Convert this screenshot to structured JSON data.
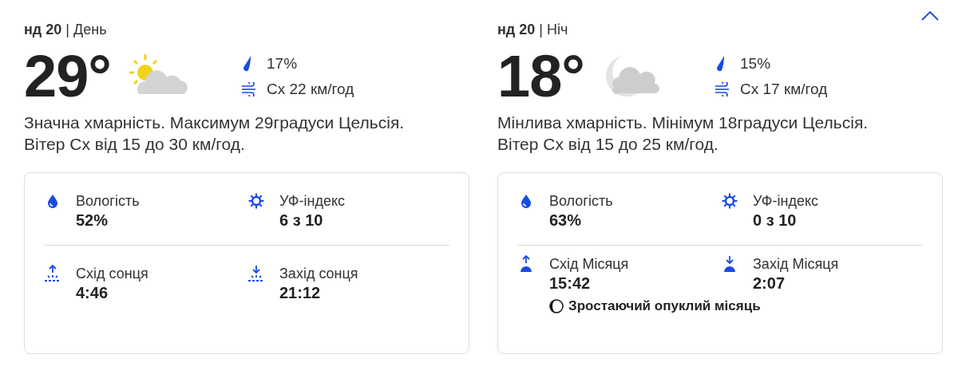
{
  "collapse_button": {
    "expanded": true
  },
  "periods": [
    {
      "heading": "**нд 20** | День",
      "temperature": "29°",
      "kind": "sun-cloud",
      "precipitation": "17%",
      "wind": "Сх 22 км/год",
      "description": "Значна хмарність. Максимум 29градуси Цельсія. Вітер Сх від 15 до 30 км/год.",
      "stats": [
        {
          "kind": "humidity",
          "label": "Вологість",
          "value": "52%"
        },
        {
          "kind": "uv",
          "label": "УФ-індекс",
          "value": "6 з 10"
        },
        {
          "kind": "sunrise",
          "label": "Схід сонця",
          "value": "4:46"
        },
        {
          "kind": "sunset",
          "label": "Захід сонця",
          "value": "21:12"
        }
      ]
    },
    {
      "heading": "**нд 20** | Ніч",
      "temperature": "18°",
      "kind": "moon-cloud",
      "precipitation": "15%",
      "wind": "Сх 17 км/год",
      "description": "Мінлива хмарність. Мінімум 18градуси Цельсія. Вітер Сх від 15 до 25 км/год.",
      "stats": [
        {
          "kind": "humidity",
          "label": "Вологість",
          "value": "63%"
        },
        {
          "kind": "uv",
          "label": "УФ-індекс",
          "value": "0 з 10"
        },
        {
          "kind": "moonrise",
          "label": "Схід Місяця",
          "value": "15:42"
        },
        {
          "kind": "moonset",
          "label": "Захід Місяця",
          "value": "2:07"
        }
      ],
      "moon_phase": "Зростаючий опуклий місяць"
    }
  ]
}
